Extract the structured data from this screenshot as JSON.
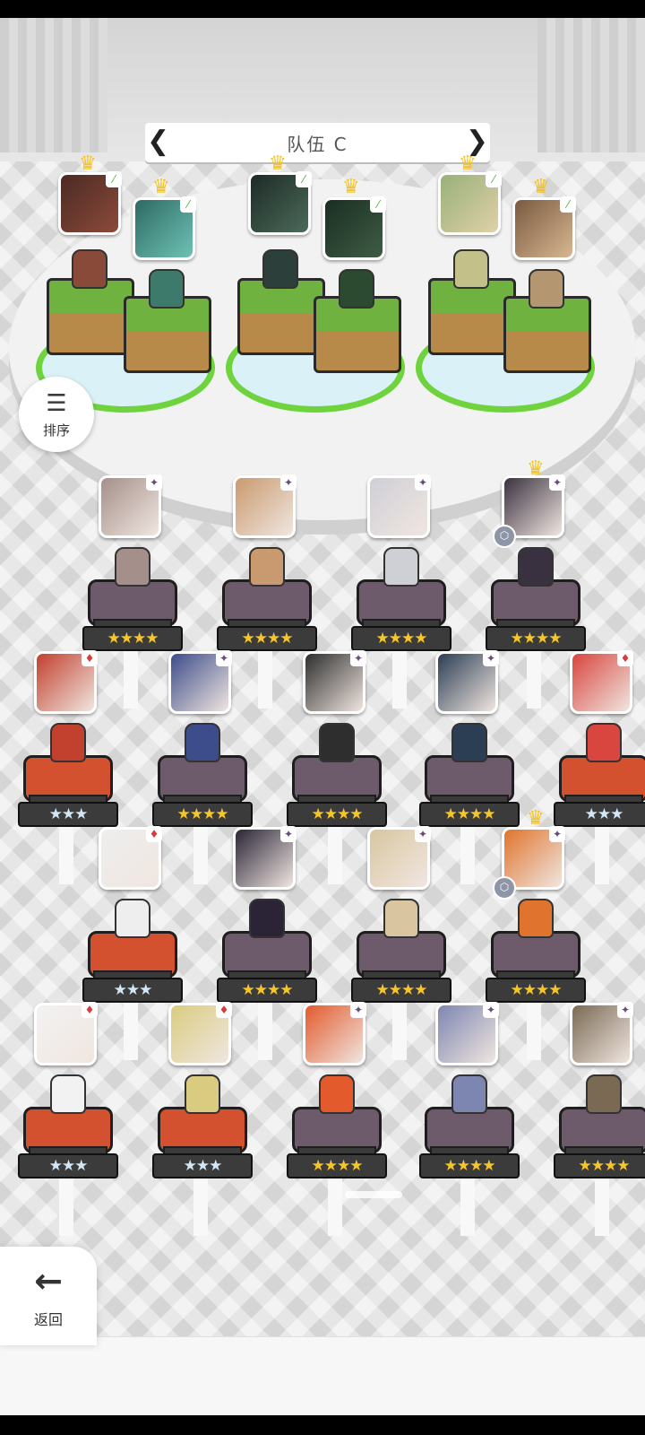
{
  "team": {
    "title": "队伍 C",
    "prev_icon": "chevron-left-icon",
    "next_icon": "chevron-right-icon"
  },
  "controls": {
    "sort_label": "排序",
    "sort_icon": "sort-list-icon",
    "back_label": "返回",
    "back_icon": "arrow-left-icon"
  },
  "colors": {
    "gold_star": "#f6c527",
    "silver_star": "#cfe7f6",
    "purple_pedestal": "#6d5a6a",
    "orange_pedestal": "#d3512f",
    "ring_green": "#6fd33d"
  },
  "team_slots": [
    {
      "element": "leaf"
    },
    {
      "element": "leaf"
    },
    {
      "element": "leaf"
    },
    {
      "element": "leaf"
    },
    {
      "element": "leaf"
    },
    {
      "element": "leaf"
    }
  ],
  "roster": [
    {
      "stars": "★★★★",
      "grade": "gold",
      "element": "star"
    },
    {
      "stars": "★★★★",
      "grade": "gold",
      "element": "star"
    },
    {
      "stars": "★★★★",
      "grade": "gold",
      "element": "star"
    },
    {
      "stars": "★★★★",
      "grade": "gold",
      "element": "star"
    },
    {
      "stars": "★★★",
      "grade": "silver",
      "element": "diamond"
    },
    {
      "stars": "★★★★",
      "grade": "gold",
      "element": "star"
    },
    {
      "stars": "★★★★",
      "grade": "gold",
      "element": "star"
    },
    {
      "stars": "★★★★",
      "grade": "gold",
      "element": "star"
    },
    {
      "stars": "★★★",
      "grade": "silver",
      "element": "diamond"
    },
    {
      "stars": "★★★",
      "grade": "silver",
      "element": "diamond"
    },
    {
      "stars": "★★★★",
      "grade": "gold",
      "element": "star"
    },
    {
      "stars": "★★★★",
      "grade": "gold",
      "element": "star"
    },
    {
      "stars": "★★★★",
      "grade": "gold",
      "element": "star"
    },
    {
      "stars": "★★★",
      "grade": "silver",
      "element": "diamond"
    },
    {
      "stars": "★★★",
      "grade": "silver",
      "element": "diamond"
    },
    {
      "stars": "★★★★",
      "grade": "gold",
      "element": "star"
    },
    {
      "stars": "★★★★",
      "grade": "gold",
      "element": "star"
    },
    {
      "stars": "★★★★",
      "grade": "gold",
      "element": "star"
    },
    {
      "stars": "★★★",
      "grade": "silver",
      "element": "diamond"
    },
    {
      "stars": "★★★",
      "grade": "silver",
      "element": "diamond"
    }
  ]
}
